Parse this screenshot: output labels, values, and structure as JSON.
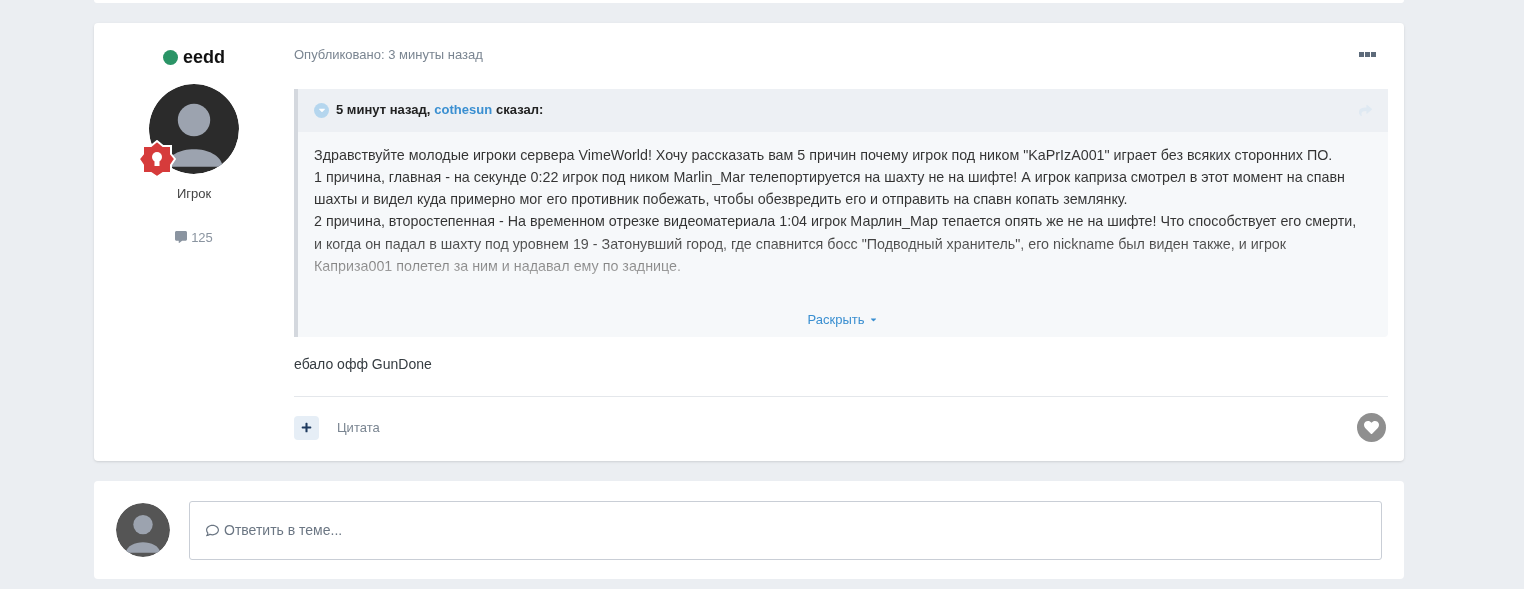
{
  "post": {
    "author": {
      "name": "eedd",
      "online": true,
      "rank": "Игрок",
      "posts": "125"
    },
    "posted": "Опубликовано: 3 минуты назад",
    "quote": {
      "time": "5 минут назад,",
      "author": "cothesun",
      "said": "сказал:",
      "paragraphs": [
        "Здравствуйте молодые игроки сервера VimeWorld! Хочу рассказать вам 5 причин почему игрок под ником \"KaPrIzA001\" играет без всяких сторонних ПО.",
        "1 причина, главная - на секунде 0:22 игрок под ником Marlin_Mar телепортируется на шахту не на шифте! А игрок каприза смотрел в этот момент на спавн шахты и видел куда примерно мог его противник побежать, чтобы обезвредить его и отправить на спавн копать землянку.",
        "2 причина, второстепенная - На временном отрезке видеоматериала 1:04 игрок Марлин_Мар тепается опять же не на шифте! Что способствует его смерти, и когда он падал в шахту под уровнем 19 - Затонувший город, где спавнится босс \"Подводный хранитель\", его nickname был виден также, и игрок Каприза001 полетел за ним и надавал ему по заднице."
      ],
      "expand": "Раскрыть"
    },
    "body": "ебало офф GunDone",
    "quote_action": "Цитата"
  },
  "reply": {
    "placeholder": "Ответить в теме..."
  }
}
